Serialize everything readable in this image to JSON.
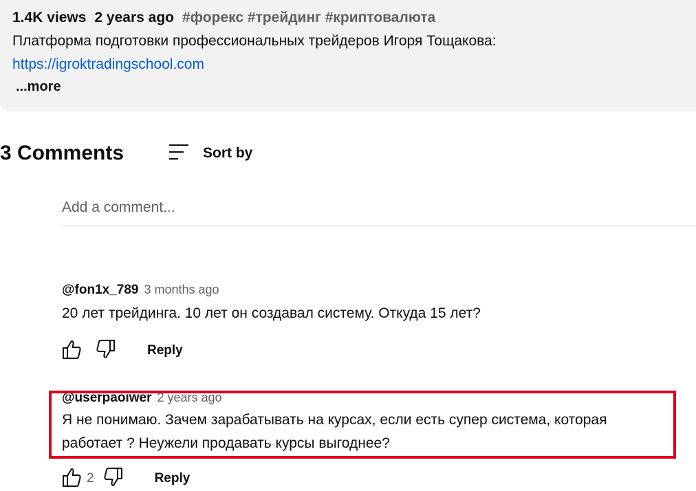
{
  "description": {
    "views": "1.4K views",
    "age": "2 years ago",
    "tags": "#форекс #трейдинг #криптовалюта",
    "text": "Платформа подготовки профессиональных трейдеров Игоря Тощакова:",
    "link": "https://igroktradingschool.com",
    "more_label": "...more"
  },
  "comments": {
    "count_label": "3 Comments",
    "sort_label": "Sort by",
    "add_placeholder": "Add a comment...",
    "items": [
      {
        "author": "@fon1x_789",
        "time": "3 months ago",
        "text": "20 лет трейдинга. 10 лет он создавал систему. Откуда 15 лет?",
        "reply_label": "Reply",
        "like_count": ""
      },
      {
        "author": "@userpaoiwer",
        "time": "2 years ago",
        "text_line1": "Я не понимаю. Зачем зарабатывать на курсах, если есть супер система, которая",
        "text_line2": "работает ? Неужели продавать курсы выгоднее?",
        "reply_label": "Reply",
        "like_count": "2"
      }
    ]
  },
  "icons": {
    "sort": "sort-icon",
    "like": "thumbs-up-icon",
    "dislike": "thumbs-down-icon"
  },
  "colors": {
    "link": "#065fd4",
    "highlight": "#e0001b",
    "description_bg": "#f2f2f2"
  }
}
